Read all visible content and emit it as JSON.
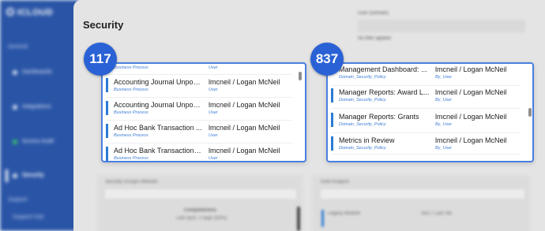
{
  "sidebar": {
    "logo": "ICLOUD",
    "section_general": "General",
    "items": [
      {
        "label": "Dashboards"
      },
      {
        "label": "Integrations"
      },
      {
        "label": "Access Audit"
      },
      {
        "label": "Security"
      }
    ],
    "section_support": "Support",
    "support_item": "Support Hub"
  },
  "page": {
    "title": "Security",
    "filter_label": "User (Domain)",
    "filter_checkbox": "No filter applied"
  },
  "background_panels": {
    "left_title": "Security Groups Affected",
    "left_heading": "Completeness",
    "left_subtext": "Last sync: 2 days (93%)",
    "right_title": "Role Analysis",
    "right_col1": "Legacy Module",
    "right_col2": "SEC / Last Val"
  },
  "panel_left": {
    "badge": "117",
    "partial_top_sub": "Business Process",
    "partial_top_osub": "User",
    "rows": [
      {
        "name": "Accounting Journal Unpos...",
        "sub": "Business Process",
        "owner": "lmcneil / Logan McNeil",
        "osub": "User"
      },
      {
        "name": "Accounting Journal Unpos...",
        "sub": "Business Process",
        "owner": "lmcneil / Logan McNeil",
        "osub": "User"
      },
      {
        "name": "Ad Hoc Bank Transaction ...",
        "sub": "Business Process",
        "owner": "lmcneil / Logan McNeil",
        "osub": "User"
      },
      {
        "name": "Ad Hoc Bank Transaction I...",
        "sub": "Business Process",
        "owner": "lmcneil / Logan McNeil",
        "osub": "User"
      }
    ]
  },
  "panel_right": {
    "badge": "837",
    "rows": [
      {
        "name": "Management Dashboard: ...",
        "sub": "Domain_Security_Policy",
        "owner": "lmcneil / Logan McNeil",
        "osub": "By_User"
      },
      {
        "name": "Manager Reports: Award L...",
        "sub": "Domain_Security_Policy",
        "owner": "lmcneil / Logan McNeil",
        "osub": "By_User"
      },
      {
        "name": "Manager Reports: Grants",
        "sub": "Domain_Security_Policy",
        "owner": "lmcneil / Logan McNeil",
        "osub": "By_User"
      },
      {
        "name": "Metrics in Review",
        "sub": "Domain_Security_Policy",
        "owner": "lmcneil / Logan McNeil",
        "osub": "By_User"
      }
    ]
  },
  "colors": {
    "accent": "#2a62d6",
    "row_bar": "#2b7bd4",
    "sidebar": "#2a55a6"
  }
}
